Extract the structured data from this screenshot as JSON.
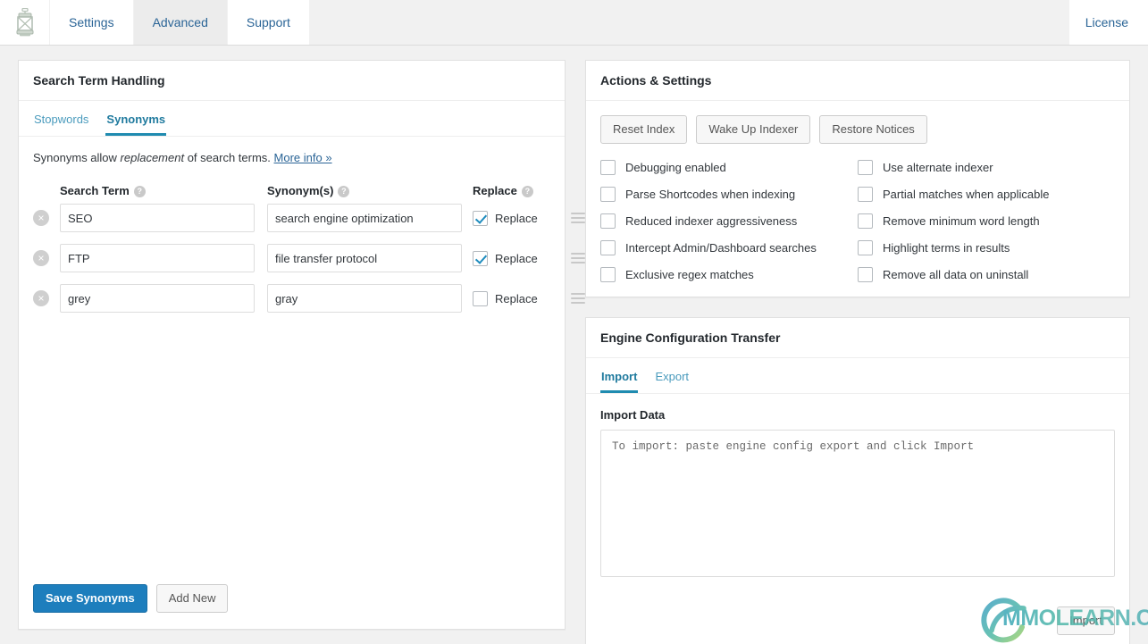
{
  "topnav": {
    "logo_icon": "lantern-icon",
    "tabs": [
      {
        "label": "Settings",
        "active": false
      },
      {
        "label": "Advanced",
        "active": true
      },
      {
        "label": "Support",
        "active": false
      }
    ],
    "license_label": "License"
  },
  "search_term_panel": {
    "title": "Search Term Handling",
    "tabs": [
      {
        "label": "Stopwords",
        "active": false
      },
      {
        "label": "Synonyms",
        "active": true
      }
    ],
    "intro_prefix": "Synonyms allow ",
    "intro_em": "replacement",
    "intro_suffix": " of search terms. ",
    "intro_link": "More info »",
    "columns": {
      "term": "Search Term",
      "synonyms": "Synonym(s)",
      "replace": "Replace",
      "help_icon": "?"
    },
    "rows": [
      {
        "term": "SEO",
        "synonym": "search engine optimization",
        "replace": true,
        "replace_label": "Replace",
        "delete_icon": "×",
        "drag_icon": "drag-handle-icon"
      },
      {
        "term": "FTP",
        "synonym": "file transfer protocol",
        "replace": true,
        "replace_label": "Replace",
        "delete_icon": "×",
        "drag_icon": "drag-handle-icon"
      },
      {
        "term": "grey",
        "synonym": "gray",
        "replace": false,
        "replace_label": "Replace",
        "delete_icon": "×",
        "drag_icon": "drag-handle-icon"
      }
    ],
    "save_label": "Save Synonyms",
    "add_label": "Add New"
  },
  "actions_panel": {
    "title": "Actions & Settings",
    "buttons": [
      {
        "label": "Reset Index"
      },
      {
        "label": "Wake Up Indexer"
      },
      {
        "label": "Restore Notices"
      }
    ],
    "checkboxes_left": [
      {
        "label": "Debugging enabled",
        "checked": false
      },
      {
        "label": "Parse Shortcodes when indexing",
        "checked": false
      },
      {
        "label": "Reduced indexer aggressiveness",
        "checked": false
      },
      {
        "label": "Intercept Admin/Dashboard searches",
        "checked": false
      },
      {
        "label": "Exclusive regex matches",
        "checked": false
      }
    ],
    "checkboxes_right": [
      {
        "label": "Use alternate indexer",
        "checked": false
      },
      {
        "label": "Partial matches when applicable",
        "checked": false
      },
      {
        "label": "Remove minimum word length",
        "checked": false
      },
      {
        "label": "Highlight terms in results",
        "checked": false
      },
      {
        "label": "Remove all data on uninstall",
        "checked": false
      }
    ]
  },
  "transfer_panel": {
    "title": "Engine Configuration Transfer",
    "tabs": [
      {
        "label": "Import",
        "active": true
      },
      {
        "label": "Export",
        "active": false
      }
    ],
    "field_label": "Import Data",
    "textarea_value": "",
    "textarea_placeholder": "To import: paste engine config export and click Import",
    "import_button": "Import"
  },
  "watermark": {
    "text": "MMOLEARN.COM",
    "logo_icon": "swirl-circle-logo"
  },
  "colors": {
    "page_bg": "#f1f1f1",
    "panel_bg": "#ffffff",
    "panel_border": "#e1e1e1",
    "link": "#2a6496",
    "tab_active": "#1f8bb0",
    "primary_button": "#1d7ebd",
    "checkbox_check": "#1e8cbe",
    "muted_icon": "#c9c9c9"
  }
}
